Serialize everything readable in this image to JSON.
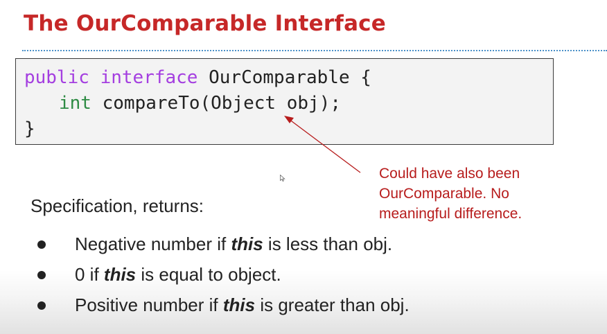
{
  "slide": {
    "title": "The OurComparable Interface",
    "accent_color": "#c62828",
    "rule_color": "#4a90c8"
  },
  "code": {
    "line1_kw1": "public",
    "line1_kw2": "interface",
    "line1_rest": " OurComparable {",
    "line2_type": "int",
    "line2_rest": " compareTo(Object obj);",
    "line3": "}",
    "keyword_color": "#a43ee0",
    "type_color": "#2e8b44"
  },
  "annotation": {
    "line1": "Could have also been",
    "line2": "OurComparable. No",
    "line3": "meaningful difference.",
    "color": "#b71c1c"
  },
  "spec": {
    "heading": "Specification, returns:",
    "bullets": [
      {
        "before": "Negative number if ",
        "emph": "this",
        "after": " is less than obj."
      },
      {
        "before": "0 if ",
        "emph": "this",
        "after": " is equal to object."
      },
      {
        "before": "Positive number if ",
        "emph": "this",
        "after": " is greater than obj."
      }
    ]
  },
  "pointer_icon": "mouse-cursor-icon"
}
